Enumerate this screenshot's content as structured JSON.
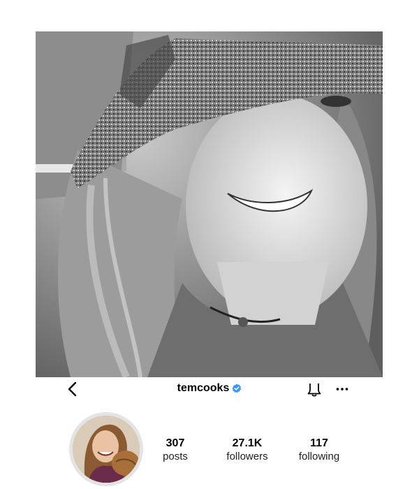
{
  "header": {
    "username": "temcooks",
    "verified": true,
    "verified_color": "#3897f0"
  },
  "icons": {
    "back": "chevron-left-icon",
    "notifications": "bell-icon",
    "more": "more-horizontal-icon",
    "verified": "verified-badge-icon"
  },
  "stats": {
    "posts": {
      "value": "307",
      "label": "posts"
    },
    "followers": {
      "value": "27.1K",
      "label": "followers"
    },
    "following": {
      "value": "117",
      "label": "following"
    }
  }
}
